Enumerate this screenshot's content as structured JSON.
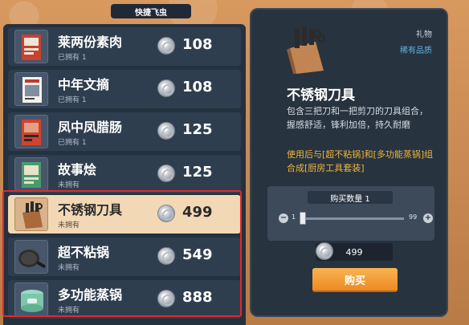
{
  "window": {
    "title": "快捷飞虫"
  },
  "items": [
    {
      "name": "莱两份素肉",
      "owned": "已拥有 1",
      "price": "108",
      "thumb_icon": "book-icon"
    },
    {
      "name": "中年文摘",
      "owned": "已拥有 1",
      "price": "108",
      "thumb_icon": "book-icon"
    },
    {
      "name": "凤中凤腊肠",
      "owned": "已拥有 1",
      "price": "125",
      "thumb_icon": "book-icon"
    },
    {
      "name": "故事烩",
      "owned": "未拥有",
      "price": "125",
      "thumb_icon": "book-icon"
    },
    {
      "name": "不锈钢刀具",
      "owned": "未拥有",
      "price": "499",
      "thumb_icon": "knife-block-icon"
    },
    {
      "name": "超不粘锅",
      "owned": "未拥有",
      "price": "549",
      "thumb_icon": "frying-pan-icon"
    },
    {
      "name": "多功能蒸锅",
      "owned": "未拥有",
      "price": "888",
      "thumb_icon": "steamer-icon"
    }
  ],
  "detail": {
    "category": "礼物",
    "rarity": "稀有品质",
    "rarity_color": "#5fb4e8",
    "title": "不锈钢刀具",
    "description": "包含三把刀和一把剪刀的刀具组合，握感舒适，锋利加倍，持久耐磨",
    "note": "使用后与[超不粘锅]和[多功能蒸锅]组合成[厨房工具套装]",
    "note_color": "#f0b63a",
    "quantity_label": "购买数量 1",
    "quantity_min": "1",
    "quantity_max": "99",
    "quantity_minus": "−",
    "quantity_plus": "+",
    "total_price": "499",
    "buy_label": "购买"
  },
  "colors": {
    "selected_row": "#f3d8b6",
    "highlight_frame": "#e0292e",
    "buy_button": "#ec8a22"
  }
}
